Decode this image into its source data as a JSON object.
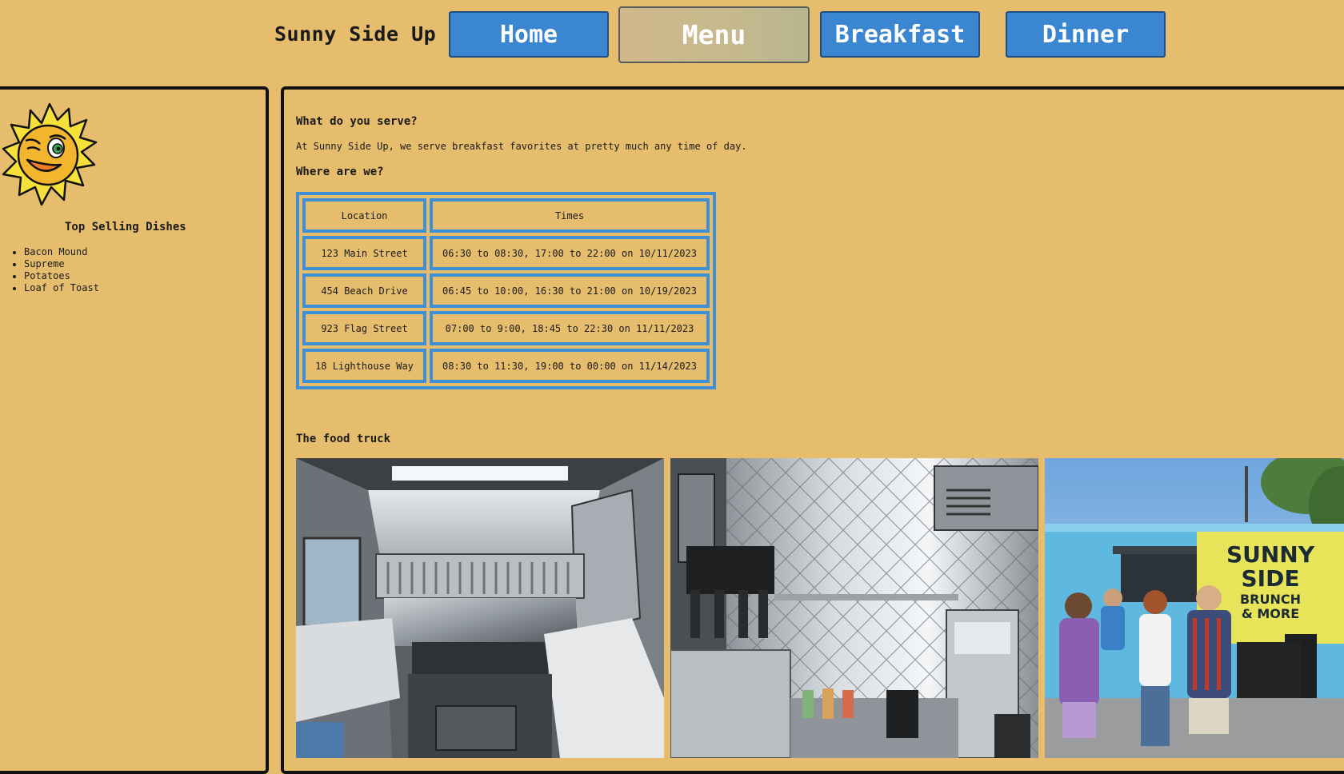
{
  "header": {
    "brand": "Sunny Side Up",
    "nav": [
      {
        "label": "Home",
        "active": false
      },
      {
        "label": "Menu",
        "active": true
      },
      {
        "label": "Breakfast",
        "active": false
      },
      {
        "label": "Dinner",
        "active": false
      }
    ]
  },
  "sidebar": {
    "title": "Top Selling Dishes",
    "dishes": [
      "Bacon Mound",
      "Supreme",
      "Potatoes",
      "Loaf of Toast"
    ]
  },
  "main": {
    "serve_heading": "What do you serve?",
    "serve_text": "At Sunny Side Up, we serve breakfast favorites at pretty much any time of day.",
    "where_heading": "Where are we?",
    "table": {
      "headers": [
        "Location",
        "Times"
      ],
      "rows": [
        [
          "123 Main Street",
          "06:30 to 08:30, 17:00 to 22:00 on 10/11/2023"
        ],
        [
          "454 Beach Drive",
          "06:45 to 10:00, 16:30 to 21:00 on 10/19/2023"
        ],
        [
          "923 Flag Street",
          "07:00 to 9:00, 18:45 to 22:30 on 11/11/2023"
        ],
        [
          "18 Lighthouse Way",
          "08:30 to 11:30, 19:00 to 00:00 on 11/14/2023"
        ]
      ]
    },
    "truck_heading": "The food truck",
    "truck_sign": {
      "line1": "SUNNY",
      "line2": "SIDE",
      "line3": "BRUNCH",
      "line4": "& MORE"
    }
  },
  "colors": {
    "background": "#e6bd6c",
    "nav_button": "#3a86d0",
    "table_border": "#3f8fd6",
    "truck_body": "#5fb8e0"
  }
}
